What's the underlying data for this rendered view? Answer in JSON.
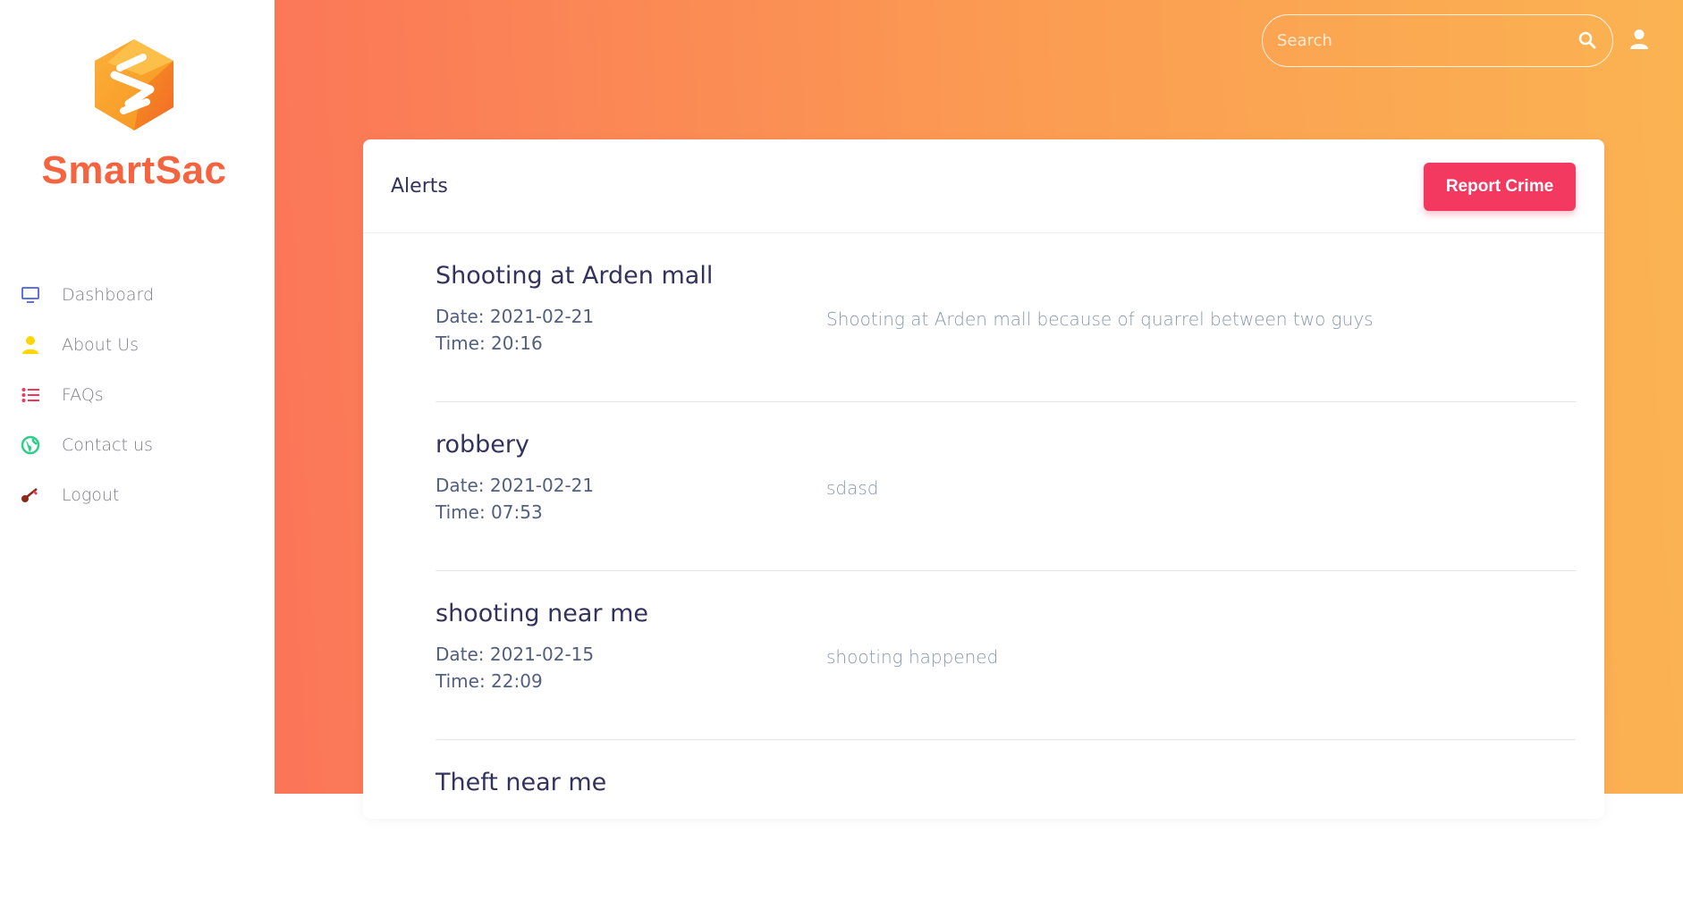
{
  "sidebar": {
    "brand": "SmartSac",
    "items": [
      {
        "label": "Dashboard",
        "icon": "monitor-icon",
        "color": "#5e72e4"
      },
      {
        "label": "About Us",
        "icon": "user-icon",
        "color": "#ffd600"
      },
      {
        "label": "FAQs",
        "icon": "list-icon",
        "color": "#f5365c"
      },
      {
        "label": "Contact us",
        "icon": "globe-icon",
        "color": "#2dce89"
      },
      {
        "label": "Logout",
        "icon": "key-icon",
        "color": "#8b2a1a"
      }
    ]
  },
  "header": {
    "search_placeholder": "Search",
    "search_icon": "search-icon",
    "user_icon": "user-icon"
  },
  "card": {
    "title": "Alerts",
    "report_label": "Report Crime"
  },
  "alerts": [
    {
      "title": "Shooting at Arden mall",
      "date": "Date: 2021-02-21",
      "time": "Time: 20:16",
      "description": "Shooting at Arden mall because of quarrel between two guys"
    },
    {
      "title": "robbery",
      "date": "Date: 2021-02-21",
      "time": "Time: 07:53",
      "description": "sdasd"
    },
    {
      "title": "shooting near me",
      "date": "Date: 2021-02-15",
      "time": "Time: 22:09",
      "description": "shooting happened"
    },
    {
      "title": "Theft near me",
      "date": "",
      "time": "",
      "description": ""
    }
  ],
  "colors": {
    "brand": "#f5633f",
    "gradient_start": "#fb7558",
    "gradient_end": "#fbb352",
    "button": "#f3395f",
    "heading": "#32325d"
  }
}
